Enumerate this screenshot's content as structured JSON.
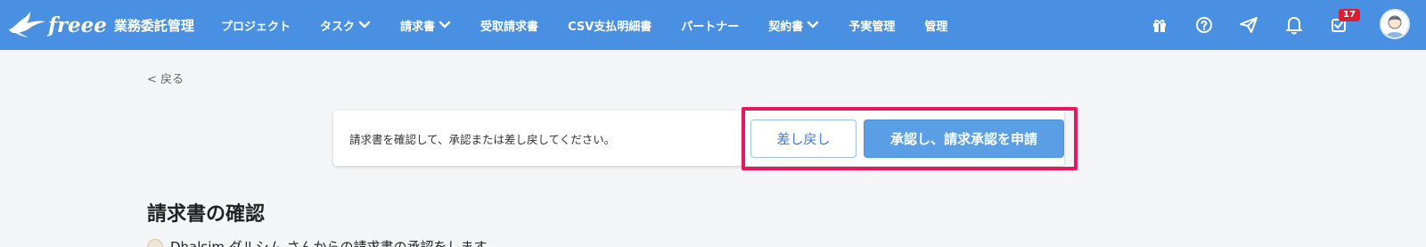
{
  "header": {
    "logo_word": "freee",
    "app_name": "業務委託管理",
    "nav": [
      {
        "label": "プロジェクト",
        "has_dropdown": false
      },
      {
        "label": "タスク",
        "has_dropdown": true
      },
      {
        "label": "請求書",
        "has_dropdown": true
      },
      {
        "label": "受取請求書",
        "has_dropdown": false
      },
      {
        "label": "CSV支払明細書",
        "has_dropdown": false
      },
      {
        "label": "パートナー",
        "has_dropdown": false
      },
      {
        "label": "契約書",
        "has_dropdown": true
      },
      {
        "label": "予実管理",
        "has_dropdown": false
      },
      {
        "label": "管理",
        "has_dropdown": false
      }
    ],
    "icons": [
      "gift-icon",
      "help-icon",
      "send-icon",
      "bell-icon",
      "inbox-icon"
    ],
    "notification_count": "17",
    "brand_color": "#4a90e2"
  },
  "back_link": "< 戻る",
  "action": {
    "message": "請求書を確認して、承認または差し戻してください。",
    "return_label": "差し戻し",
    "approve_label": "承認し、請求承認を申請",
    "highlight_color": "#e8175d"
  },
  "main": {
    "title": "請求書の確認",
    "requester_text": "Dhalsim ダルシム さんからの請求書の承認をします"
  }
}
